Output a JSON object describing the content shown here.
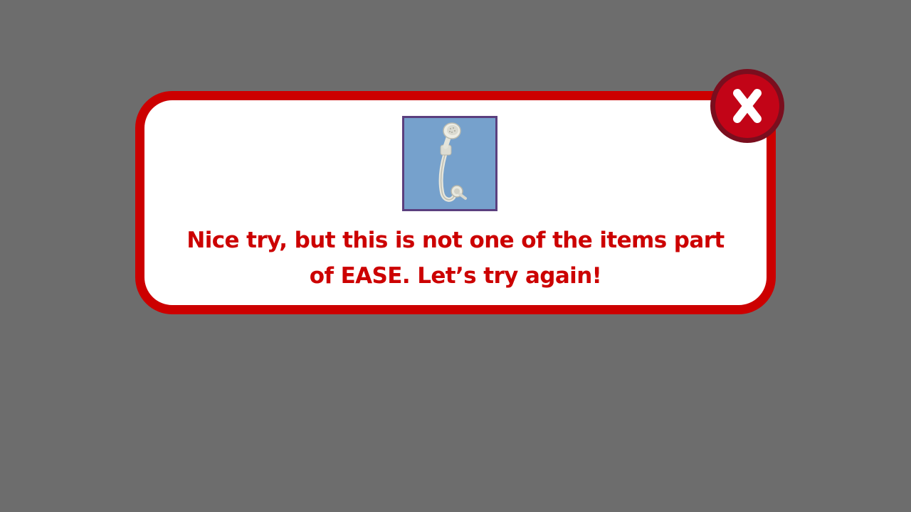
{
  "dialog": {
    "message_line1": "Nice try, but this is not one of the items part",
    "message_line2": "of EASE. Let’s try again!",
    "image_icon": "handheld-shower-icon",
    "close_icon": "close-x-icon"
  },
  "colors": {
    "background": "#6d6d6d",
    "dialog_border": "#cc0000",
    "dialog_fill": "#ffffff",
    "message_text": "#cc0000",
    "image_background": "#76a1cc",
    "image_border": "#5b3f7e",
    "close_button": "#c20417",
    "close_button_ring": "#7a0e1e"
  }
}
